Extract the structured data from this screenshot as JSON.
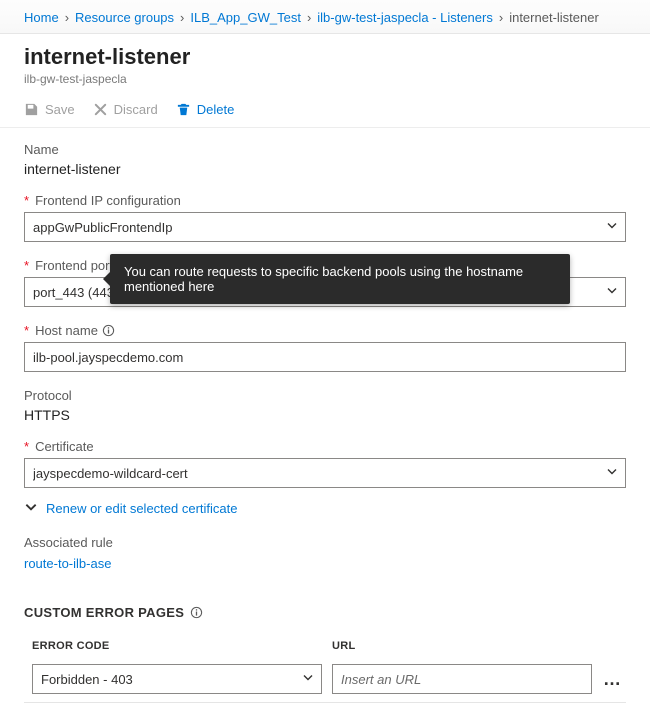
{
  "breadcrumb": {
    "items": [
      {
        "label": "Home"
      },
      {
        "label": "Resource groups"
      },
      {
        "label": "ILB_App_GW_Test"
      },
      {
        "label": "ilb-gw-test-jaspecla - Listeners"
      }
    ],
    "current": "internet-listener"
  },
  "header": {
    "title": "internet-listener",
    "subtitle": "ilb-gw-test-jaspecla"
  },
  "toolbar": {
    "save_label": "Save",
    "discard_label": "Discard",
    "delete_label": "Delete"
  },
  "form": {
    "name_label": "Name",
    "name_value": "internet-listener",
    "frontend_ip_label": "Frontend IP configuration",
    "frontend_ip_value": "appGwPublicFrontendIp",
    "frontend_port_label": "Frontend port",
    "frontend_port_value": "port_443 (443)",
    "hostname_label": "Host name",
    "hostname_value": "ilb-pool.jayspecdemo.com",
    "hostname_tooltip": "You can route requests to specific backend pools using the hostname mentioned here",
    "protocol_label": "Protocol",
    "protocol_value": "HTTPS",
    "certificate_label": "Certificate",
    "certificate_value": "jayspecdemo-wildcard-cert",
    "renew_link": "Renew or edit selected certificate",
    "associated_rule_label": "Associated rule",
    "associated_rule_value": "route-to-ilb-ase"
  },
  "customErrors": {
    "section_title": "CUSTOM ERROR PAGES",
    "col_error_code": "ERROR CODE",
    "col_url": "URL",
    "url_placeholder": "Insert an URL",
    "rows": [
      {
        "code": "Forbidden - 403",
        "url": ""
      }
    ]
  }
}
